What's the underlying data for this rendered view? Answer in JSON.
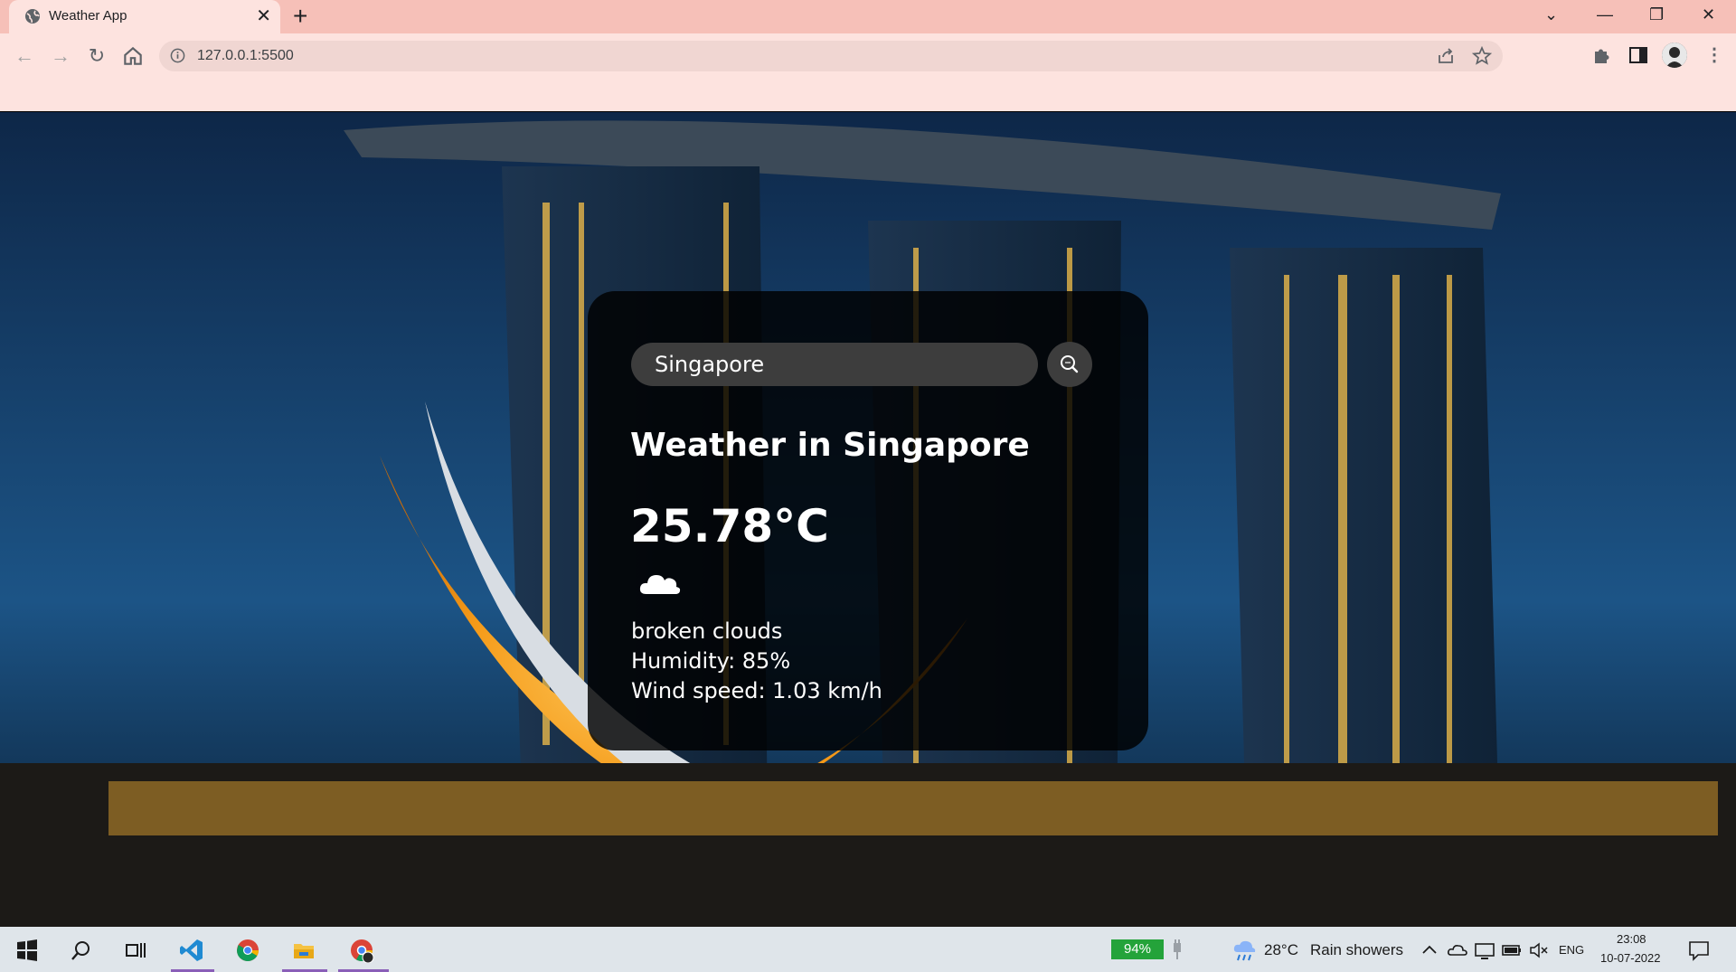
{
  "browser": {
    "tab_title": "Weather App",
    "tab_close": "✕",
    "new_tab": "+",
    "url": "127.0.0.1:5500",
    "window_controls": {
      "chevron": "⌄",
      "minimize": "—",
      "restore": "❐",
      "close": "✕"
    },
    "nav": {
      "back": "←",
      "forward": "→",
      "reload": "↻",
      "menu": "⋮"
    }
  },
  "weather_app": {
    "search": {
      "value": "Singapore",
      "placeholder": "Search"
    },
    "title": "Weather in Singapore",
    "temperature": "25.78°C",
    "icon": "cloud-icon",
    "description": "broken clouds",
    "humidity": "Humidity: 85%",
    "wind": "Wind speed: 1.03 km/h"
  },
  "taskbar": {
    "battery": "94%",
    "weather_temp": "28°C",
    "weather_desc": "Rain showers",
    "language": "ENG",
    "time": "23:08",
    "date": "10-07-2022"
  },
  "colors": {
    "tabstrip": "#f6c0b8",
    "toolbar": "#fde3df",
    "card": "#000000d1",
    "taskbar": "#dfe5ea",
    "battery": "#24a33a"
  }
}
